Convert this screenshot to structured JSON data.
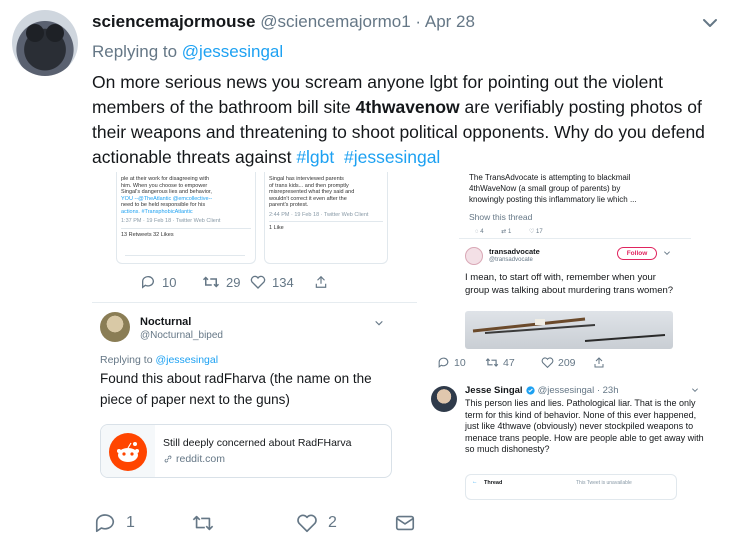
{
  "tweet": {
    "display_name": "sciencemajormouse",
    "handle": "@sciencemajormo1",
    "separator": " · ",
    "date": "Apr 28",
    "replying_prefix": "Replying to ",
    "replying_to": "@jessesingal",
    "text_part1": "On more serious news you scream anyone lgbt for pointing out the violent members of the bathroom bill site ",
    "text_bold": "4thwavenow",
    "text_part2": " are verifiably posting photos of their weapons and threatening to shoot political opponents. Why do you defend actionable threats against ",
    "tag1": "#lgbt",
    "tag2": "#jessesingal"
  },
  "left_shot": {
    "col1_lines": [
      "ple at their work for disagreeing with",
      "him. When you choose to empower",
      "Singal's dangerous lies and behavior,",
      "YOU --@TheAtlantic @emcollective--",
      "need to be held responsible for his",
      "actions.  #TransphobicAtlantic"
    ],
    "col1_meta": "1:37 PM · 19 Feb 18 · Twitter Web Client",
    "col1_stats": "13 Retweets   32 Likes",
    "col2_lines": [
      "Singal has interviewed parents",
      "of trans kids... and then promptly",
      "misrepresented what they said and",
      "wouldn't correct it even after the",
      "parent's protest."
    ],
    "col2_meta": "2:44 PM · 19 Feb 18 · Twitter Web Client",
    "col2_stats": "1 Like",
    "replies": "10",
    "retweets": "29",
    "likes": "134",
    "nested_name": "Nocturnal",
    "nested_handle": "@Nocturnal_biped",
    "nested_replying_prefix": "Replying to ",
    "nested_replying_to": "@jessesingal",
    "nested_text": "Found this about radFharva (the name on the piece of paper next to the guns)",
    "link_title": "Still deeply concerned about RadFHarva",
    "link_domain": "reddit.com"
  },
  "right_shot": {
    "top_lines": [
      "The TransAdvocate is attempting to blackmail",
      "4thWaveNow (a small group of parents) by",
      "knowingly posting this inflammatory lie which ..."
    ],
    "show_thread": "Show this thread",
    "mini_counts": [
      "4",
      "1",
      "17"
    ],
    "quoted_name": "transadvocate",
    "quoted_handle": "@transadvocate",
    "follow": "Follow",
    "quoted_text": "I mean, to start off with, remember when your group was talking about murdering trans women?",
    "replies": "10",
    "retweets": "47",
    "likes": "209",
    "jesse_name": "Jesse Singal",
    "jesse_handle": "@jessesingal · 23h",
    "jesse_text": "This person lies and lies. Pathological liar. That is the only term for this kind of behavior. None of this ever happened, just like 4thwave (obviously) never stockpiled weapons to menace trans people. How are people able to get away with so much dishonesty?",
    "thread_label": "Thread",
    "unavailable": "This Tweet is unavailable"
  },
  "footer": {
    "reply_count": "1",
    "retweet_count": "",
    "like_count": "2"
  },
  "colors": {
    "accent": "#1da1f2",
    "text": "#14171a",
    "muted": "#657786",
    "reddit": "#ff4500"
  }
}
